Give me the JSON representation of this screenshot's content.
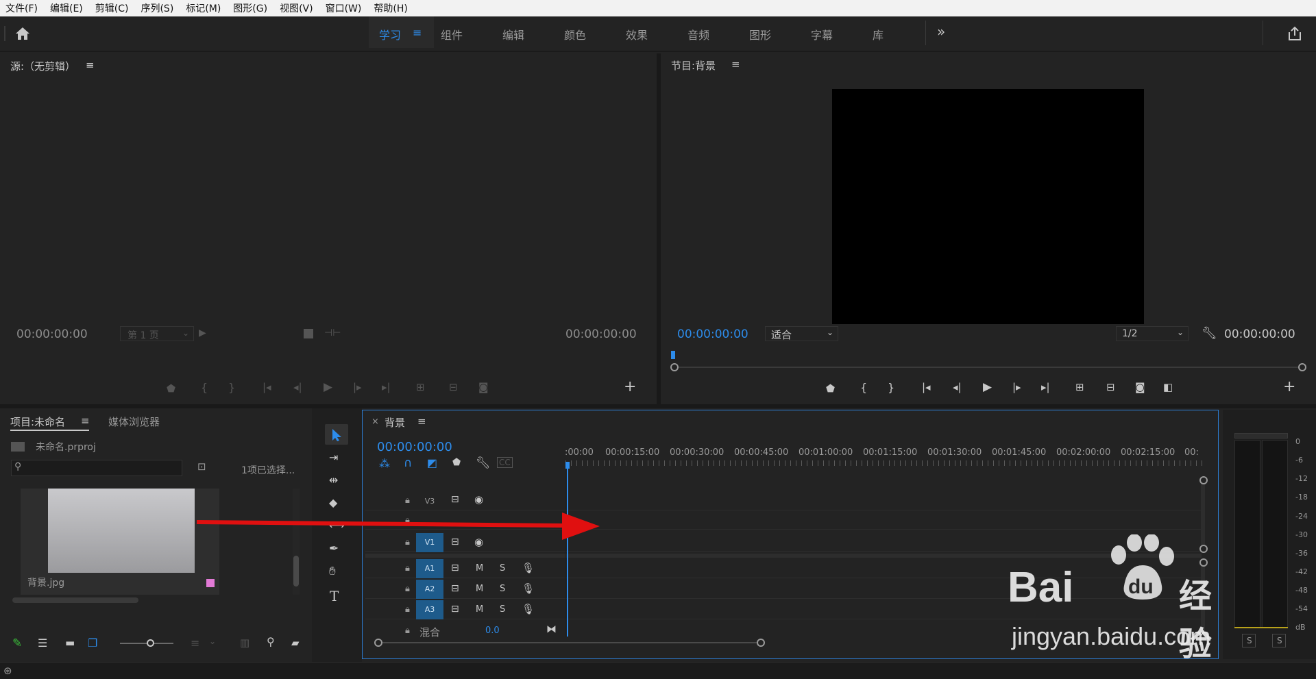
{
  "menubar": [
    "文件(F)",
    "编辑(E)",
    "剪辑(C)",
    "序列(S)",
    "标记(M)",
    "图形(G)",
    "视图(V)",
    "窗口(W)",
    "帮助(H)"
  ],
  "workspaces": [
    "学习",
    "组件",
    "编辑",
    "颜色",
    "效果",
    "音频",
    "图形",
    "字幕",
    "库"
  ],
  "workspaces_more": "»",
  "source": {
    "title": "源:（无剪辑）",
    "tc_left": "00:00:00:00",
    "page": "第 1 页",
    "tc_right": "00:00:00:00"
  },
  "program": {
    "title": "节目:背景",
    "tc_left": "00:00:00:00",
    "fit": "适合",
    "ratio": "1/2",
    "tc_right": "00:00:00:00"
  },
  "project": {
    "tab_project": "项目:未命名",
    "tab_media": "媒体浏览器",
    "file": "未命名.prproj",
    "selected": "1项已选择...",
    "item_name": "背景.jpg"
  },
  "timeline": {
    "title": "背景",
    "timecode": "00:00:00:00",
    "ruler": [
      ":00:00",
      "00:00:15:00",
      "00:00:30:00",
      "00:00:45:00",
      "00:01:00:00",
      "00:01:15:00",
      "00:01:30:00",
      "00:01:45:00",
      "00:02:00:00",
      "00:02:15:00",
      "00:"
    ],
    "tracks": {
      "v3": "V3",
      "v1": "V1",
      "a1": "A1",
      "a2": "A2",
      "a3": "A3",
      "mix": "混合",
      "mix_value": "0.0",
      "m": "M",
      "s": "S"
    }
  },
  "meter": {
    "labels": [
      "0",
      "-6",
      "-12",
      "-18",
      "-24",
      "-30",
      "-36",
      "-42",
      "-48",
      "-54",
      "dB"
    ],
    "solo": "S"
  },
  "watermark": {
    "brand": "Bai",
    "du": "du",
    "jingyan": "经验",
    "url": "jingyan.baidu.com"
  },
  "colors": {
    "accent": "#2d8ceb",
    "track_active": "#1e5b8b",
    "arrow": "#e01010",
    "label_pink": "#e27ad6"
  }
}
